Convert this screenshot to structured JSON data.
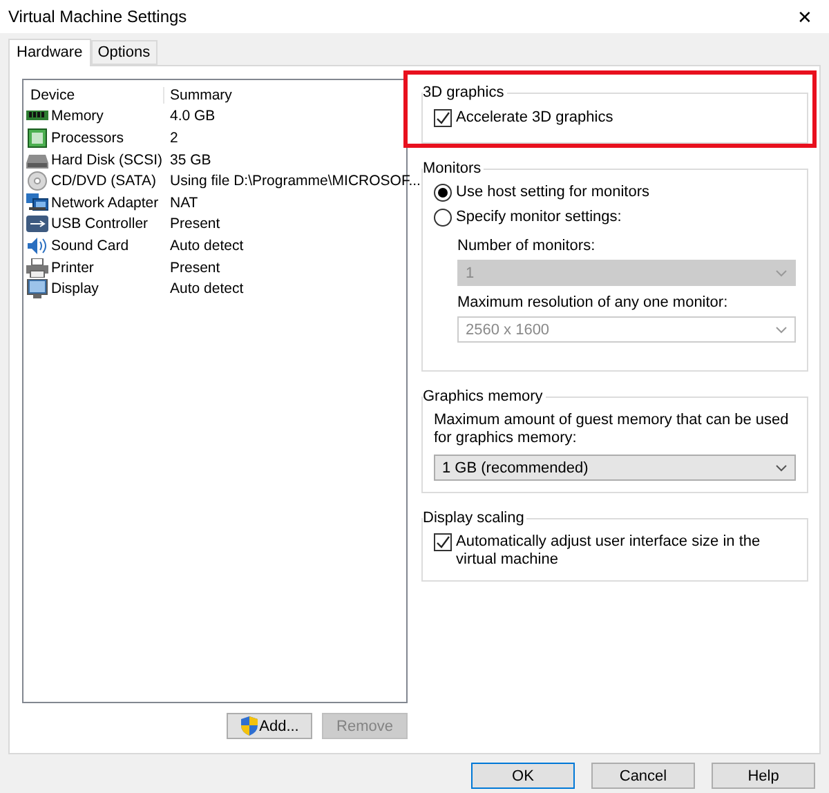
{
  "window": {
    "title": "Virtual Machine Settings",
    "close": "✕"
  },
  "tabs": [
    {
      "label": "Hardware",
      "selected": true
    },
    {
      "label": "Options",
      "selected": false
    }
  ],
  "devices": {
    "columns": [
      "Device",
      "Summary"
    ],
    "rows": [
      {
        "kind": "memory",
        "device": "Memory",
        "summary": "4.0 GB"
      },
      {
        "kind": "processor",
        "device": "Processors",
        "summary": "2"
      },
      {
        "kind": "disk",
        "device": "Hard Disk (SCSI)",
        "summary": "35 GB"
      },
      {
        "kind": "cd",
        "device": "CD/DVD (SATA)",
        "summary": "Using file D:\\Programme\\MICROSOF..."
      },
      {
        "kind": "network",
        "device": "Network Adapter",
        "summary": "NAT"
      },
      {
        "kind": "usb",
        "device": "USB Controller",
        "summary": "Present"
      },
      {
        "kind": "sound",
        "device": "Sound Card",
        "summary": "Auto detect"
      },
      {
        "kind": "printer",
        "device": "Printer",
        "summary": "Present"
      },
      {
        "kind": "display",
        "device": "Display",
        "summary": "Auto detect"
      }
    ]
  },
  "list_buttons": [
    {
      "label": "Add...",
      "disabled": false,
      "shield": true
    },
    {
      "label": "Remove",
      "disabled": true,
      "shield": false
    }
  ],
  "graphics_3d": {
    "title": "3D graphics",
    "highlighted": true,
    "accelerate": {
      "label": "Accelerate 3D graphics",
      "checked": true
    }
  },
  "monitors": {
    "title": "Monitors",
    "options": [
      {
        "label": "Use host setting for monitors",
        "selected": true
      },
      {
        "label": "Specify monitor settings:",
        "selected": false
      }
    ],
    "fields": [
      {
        "label": "Number of monitors:",
        "value": "1",
        "disabled": true,
        "filled": true
      },
      {
        "label": "Maximum resolution of any one monitor:",
        "value": "2560 x 1600",
        "disabled": true,
        "filled": false
      }
    ]
  },
  "graphics_memory": {
    "title": "Graphics memory",
    "description": "Maximum amount of guest memory that can be used for graphics memory:",
    "value": "1 GB (recommended)"
  },
  "display_scaling": {
    "title": "Display scaling",
    "auto_adjust": {
      "label": "Automatically adjust user interface size in the virtual machine",
      "checked": true
    }
  },
  "buttons": [
    {
      "label": "OK",
      "default": true
    },
    {
      "label": "Cancel",
      "default": false
    },
    {
      "label": "Help",
      "default": false
    }
  ]
}
